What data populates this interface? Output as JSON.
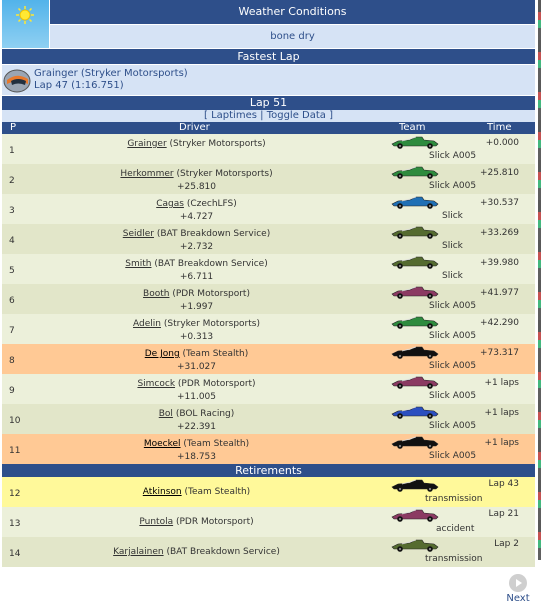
{
  "weather": {
    "title": "Weather Conditions",
    "value": "bone dry",
    "icon": "sun-icon"
  },
  "fastest_lap": {
    "title": "Fastest Lap",
    "driver_line": "Grainger (Stryker Motorsports)",
    "lap_line": "Lap 47 (1:16.751)",
    "icon": "helmet-icon"
  },
  "lap": {
    "title": "Lap 51",
    "link_laptimes": "Laptimes",
    "link_toggle": "Toggle Data",
    "bracket_open": "[",
    "separator": "|",
    "bracket_close": "]"
  },
  "columns": {
    "pos": "P",
    "driver": "Driver",
    "team": "Team",
    "time": "Time"
  },
  "standings": [
    {
      "pos": "1",
      "name": "Grainger",
      "team": "(Stryker Motorsports)",
      "gap": "",
      "tyre": "Slick A005",
      "time": "+0.000",
      "style": "c1",
      "car": "#2e8b3e"
    },
    {
      "pos": "2",
      "name": "Herkommer",
      "team": "(Stryker Motorsports)",
      "gap": "+25.810",
      "tyre": "Slick A005",
      "time": "+25.810",
      "style": "c2",
      "car": "#2e8b3e"
    },
    {
      "pos": "3",
      "name": "Cagas",
      "team": "(CzechLFS)",
      "gap": "+4.727",
      "tyre": "Slick",
      "time": "+30.537",
      "style": "c1",
      "car": "#1f6fb5"
    },
    {
      "pos": "4",
      "name": "Seidler",
      "team": "(BAT Breakdown Service)",
      "gap": "+2.732",
      "tyre": "Slick",
      "time": "+33.269",
      "style": "c2",
      "car": "#556b2f"
    },
    {
      "pos": "5",
      "name": "Smith",
      "team": "(BAT Breakdown Service)",
      "gap": "+6.711",
      "tyre": "Slick",
      "time": "+39.980",
      "style": "c1",
      "car": "#556b2f"
    },
    {
      "pos": "6",
      "name": "Booth",
      "team": "(PDR Motorsport)",
      "gap": "+1.997",
      "tyre": "Slick A005",
      "time": "+41.977",
      "style": "c2",
      "car": "#8b3a62"
    },
    {
      "pos": "7",
      "name": "Adelin",
      "team": "(Stryker Motorsports)",
      "gap": "+0.313",
      "tyre": "Slick A005",
      "time": "+42.290",
      "style": "c1",
      "car": "#2e8b3e"
    },
    {
      "pos": "8",
      "name": "De Jong",
      "team": "(Team Stealth)",
      "gap": "+31.027",
      "tyre": "Slick A005",
      "time": "+73.317",
      "style": "c3",
      "car": "#111111"
    },
    {
      "pos": "9",
      "name": "Simcock",
      "team": "(PDR Motorsport)",
      "gap": "+11.005",
      "tyre": "Slick A005",
      "time": "+1 laps",
      "style": "c1",
      "car": "#8b3a62"
    },
    {
      "pos": "10",
      "name": "Bol",
      "team": "(BOL Racing)",
      "gap": "+22.391",
      "tyre": "Slick A005",
      "time": "+1 laps",
      "style": "c2",
      "car": "#2b4fc0"
    },
    {
      "pos": "11",
      "name": "Moeckel",
      "team": "(Team Stealth)",
      "gap": "+18.753",
      "tyre": "Slick A005",
      "time": "+1 laps",
      "style": "c3",
      "car": "#111111"
    }
  ],
  "retirements": {
    "title": "Retirements",
    "rows": [
      {
        "pos": "12",
        "name": "Atkinson",
        "team": "(Team Stealth)",
        "note": "transmission",
        "time": "Lap 43",
        "style": "cy",
        "car": "#111111"
      },
      {
        "pos": "13",
        "name": "Puntola",
        "team": "(PDR Motorsport)",
        "note": "accident",
        "time": "Lap 21",
        "style": "c1",
        "car": "#8b3a62"
      },
      {
        "pos": "14",
        "name": "Karjalainen",
        "team": "(BAT Breakdown Service)",
        "note": "transmission",
        "time": "Lap 2",
        "style": "c2",
        "car": "#556b2f"
      }
    ]
  },
  "nav": {
    "next_label": "Next",
    "next_icon": "arrow-right-icon"
  },
  "colors": {
    "header": "#2e4f8a",
    "light": "#d6e3f5",
    "row_a": "#ecf0da",
    "row_b": "#e2e6c9",
    "highlight": "#ffc995",
    "retire_highlight": "#fff99a"
  }
}
